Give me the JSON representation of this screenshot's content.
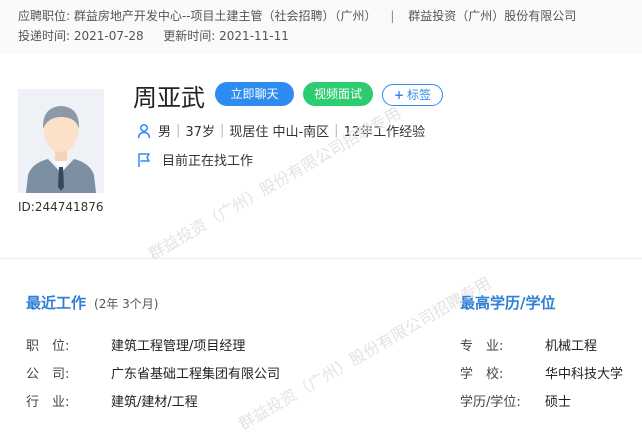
{
  "header": {
    "position_label": "应聘职位:",
    "position_value": "群益房地产开发中心--项目土建主管（社会招聘）（广州）",
    "separator": "|",
    "company": "群益投资（广州）股份有限公司",
    "submit_label": "投递时间:",
    "submit_date": "2021-07-28",
    "update_label": "更新时间:",
    "update_date": "2021-11-11"
  },
  "profile": {
    "name": "周亚武",
    "id_text": "ID:244741876",
    "gender": "男",
    "age": "37岁",
    "location": "现居住 中山-南区",
    "experience": "12年工作经验",
    "job_status": "目前正在找工作"
  },
  "actions": {
    "chat": "立即聊天",
    "video": "视频面试",
    "tag": "标签",
    "tag_plus": "+"
  },
  "work": {
    "title": "最近工作",
    "duration": "(2年 3个月)",
    "rows": [
      {
        "label": "职　位:",
        "value": "建筑工程管理/项目经理"
      },
      {
        "label": "公　司:",
        "value": "广东省基础工程集团有限公司"
      },
      {
        "label": "行　业:",
        "value": "建筑/建材/工程"
      }
    ]
  },
  "education": {
    "title": "最高学历/学位",
    "rows": [
      {
        "label": "专　业:",
        "value": "机械工程"
      },
      {
        "label": "学　校:",
        "value": "华中科技大学"
      },
      {
        "label": "学历/学位:",
        "value": "硕士"
      }
    ]
  },
  "watermarks": [
    "群益投资（广州）股份有限公司招聘专用",
    "群益投资（广州）股份有限公司招聘专用"
  ],
  "colors": {
    "accent": "#2e8cf0",
    "green": "#2ecc71",
    "section_title": "#2e7fd6"
  }
}
